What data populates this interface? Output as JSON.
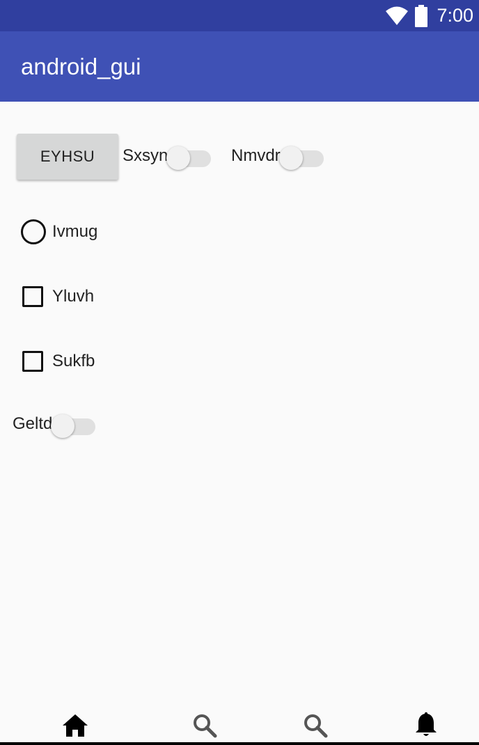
{
  "status_bar": {
    "time": "7:00",
    "icons": [
      "wifi-icon",
      "battery-icon"
    ]
  },
  "app_bar": {
    "title": "android_gui"
  },
  "content": {
    "button_label": "EYHSU",
    "switches": [
      {
        "label": "Sxsyn",
        "checked": false
      },
      {
        "label": "Nmvdr",
        "checked": false
      },
      {
        "label": "Geltd",
        "checked": false
      }
    ],
    "radio": {
      "label": "Ivmug",
      "checked": false
    },
    "checkboxes": [
      {
        "label": "Yluvh",
        "checked": false
      },
      {
        "label": "Sukfb",
        "checked": false
      }
    ]
  },
  "bottom_nav": {
    "items": [
      "home-icon",
      "search-icon",
      "search-icon",
      "notifications-icon"
    ]
  },
  "colors": {
    "status_bar": "#303f9f",
    "app_bar": "#3f51b5",
    "background": "#fafafa",
    "button": "#d6d7d7"
  }
}
